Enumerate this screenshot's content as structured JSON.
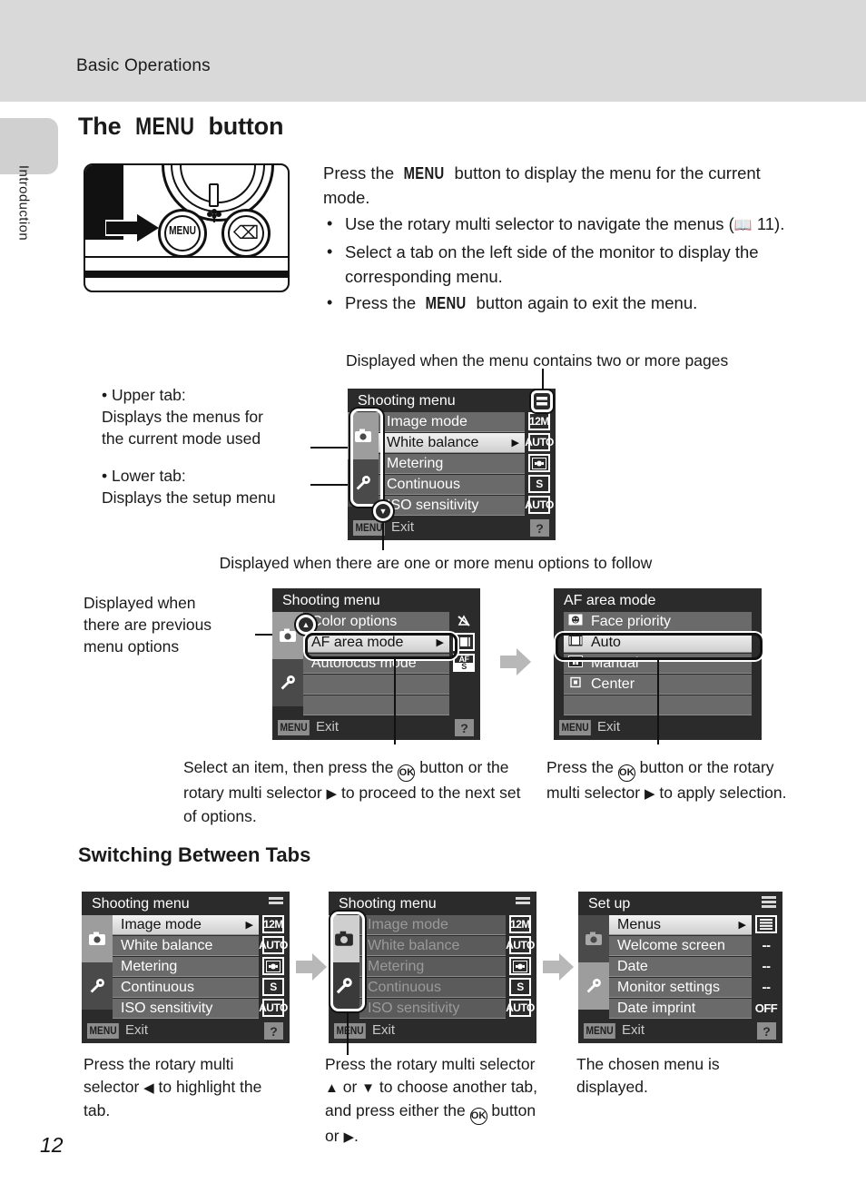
{
  "header": {
    "running_head": "Basic Operations"
  },
  "edge_tab": {
    "label": "Introduction"
  },
  "page": {
    "number": "12"
  },
  "section": {
    "title_pre": "The ",
    "title_menu": "MENU",
    "title_post": " button",
    "subsection_title": "Switching Between Tabs"
  },
  "intro": {
    "lead_pre": "Press the ",
    "lead_menu": "MENU",
    "lead_post": " button to display the menu for the current mode.",
    "bullets": [
      {
        "pre": "Use the rotary multi selector to navigate the menus (",
        "icon": "book-icon",
        "ref": " 11).",
        "post": ""
      },
      {
        "pre": "Select a tab on the left side of the monitor to display the corresponding menu.",
        "ref": "",
        "post": ""
      },
      {
        "pre": "Press the ",
        "menu": "MENU",
        "post": " button again to exit the menu."
      }
    ]
  },
  "annotations": {
    "top_pages": "Displayed when the menu contains two or more pages",
    "upper_tab": "• Upper tab:\nDisplays the menus for\nthe current mode used",
    "lower_tab": "• Lower tab:\nDisplays the setup menu",
    "more_options": "Displayed when there are one or more menu options to follow",
    "previous_options": "Displayed when\nthere are previous\nmenu options"
  },
  "screens": {
    "shooting_menu_1": {
      "title": "Shooting menu",
      "tabs": [
        {
          "icon": "camera-icon",
          "state": "active"
        },
        {
          "icon": "wrench-icon",
          "state": "inactive"
        }
      ],
      "items": [
        {
          "label": "Image mode",
          "value": "12M",
          "selected": false
        },
        {
          "label": "White balance",
          "value": "AUTO",
          "selected": true
        },
        {
          "label": "Metering",
          "value": "metering-icon",
          "selected": false
        },
        {
          "label": "Continuous",
          "value": "S",
          "selected": false
        },
        {
          "label": "ISO sensitivity",
          "value": "AUTO",
          "selected": false
        }
      ],
      "exit_chip": "MENU",
      "exit_label": "Exit",
      "help": "?"
    },
    "shooting_menu_2": {
      "title": "Shooting menu",
      "items": [
        {
          "label": "Color options",
          "value": "color-off-icon",
          "selected": false
        },
        {
          "label": "AF area mode",
          "value": "af-area-icon",
          "selected": true
        },
        {
          "label": "Autofocus mode",
          "value": "AF S",
          "selected": false
        }
      ],
      "exit_chip": "MENU",
      "exit_label": "Exit",
      "help": "?"
    },
    "af_area_mode": {
      "title": "AF area mode",
      "items": [
        {
          "label": "Face priority",
          "icon": "face-icon",
          "selected": false
        },
        {
          "label": "Auto",
          "icon": "auto-af-icon",
          "selected": true
        },
        {
          "label": "Manual",
          "icon": "manual-af-icon",
          "selected": false
        },
        {
          "label": "Center",
          "icon": "center-af-icon",
          "selected": false
        }
      ],
      "exit_chip": "MENU",
      "exit_label": "Exit"
    },
    "tabs_step1": {
      "title": "Shooting menu",
      "items": [
        {
          "label": "Image mode",
          "value": "12M",
          "selected": true
        },
        {
          "label": "White balance",
          "value": "AUTO",
          "selected": false
        },
        {
          "label": "Metering",
          "value": "metering-icon",
          "selected": false
        },
        {
          "label": "Continuous",
          "value": "S",
          "selected": false
        },
        {
          "label": "ISO sensitivity",
          "value": "AUTO",
          "selected": false
        }
      ],
      "exit_chip": "MENU",
      "exit_label": "Exit",
      "help": "?"
    },
    "tabs_step2": {
      "title": "Shooting menu",
      "items": [
        {
          "label": "Image mode",
          "value": "12M",
          "selected": false
        },
        {
          "label": "White balance",
          "value": "AUTO",
          "selected": false
        },
        {
          "label": "Metering",
          "value": "metering-icon",
          "selected": false
        },
        {
          "label": "Continuous",
          "value": "S",
          "selected": false
        },
        {
          "label": "ISO sensitivity",
          "value": "AUTO",
          "selected": false
        }
      ],
      "exit_chip": "MENU",
      "exit_label": "Exit"
    },
    "tabs_step3": {
      "title": "Set up",
      "items": [
        {
          "label": "Menus",
          "value": "menus-icon",
          "selected": true
        },
        {
          "label": "Welcome screen",
          "value": "--",
          "selected": false
        },
        {
          "label": "Date",
          "value": "--",
          "selected": false
        },
        {
          "label": "Monitor settings",
          "value": "--",
          "selected": false
        },
        {
          "label": "Date imprint",
          "value": "OFF",
          "selected": false
        }
      ],
      "exit_chip": "MENU",
      "exit_label": "Exit",
      "help": "?"
    }
  },
  "captions": {
    "select_item": "Select an item, then press the OK button or the rotary multi selector ▶ to proceed to the next set of options.",
    "apply_selection": "Press the OK button or the rotary multi selector ▶ to apply selection.",
    "tabs_step1": "Press the rotary multi selector ◀ to highlight the tab.",
    "tabs_step2": "Press the rotary multi selector ▲ or ▼ to choose another tab, and press either the OK button or ▶.",
    "tabs_step3": "The chosen menu is displayed."
  },
  "camera_illustration": {
    "menu_button_label": "MENU",
    "delete_icon": "trash-icon",
    "macro_icon": "flower-icon",
    "pointer_icon": "right-arrow-icon"
  }
}
